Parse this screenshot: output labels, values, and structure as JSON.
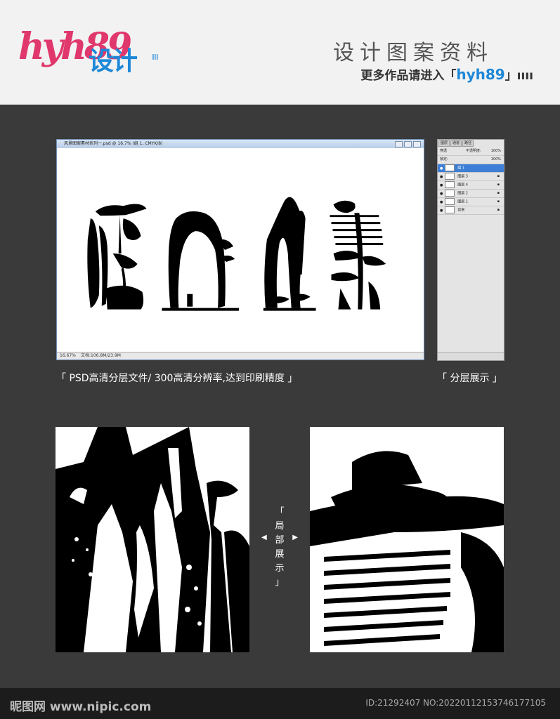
{
  "header": {
    "logo_latin": "hyh89",
    "logo_cn": "设计",
    "logo_bars": "ııı",
    "title": "设计图案资料",
    "subtitle_prefix": "更多作品请进入「",
    "subtitle_brand": "hyh89",
    "subtitle_suffix": "」ıııı"
  },
  "ps_window": {
    "title": "风景图案素材系列一.psd @ 16.7% (组 1, CMYK/8)",
    "zoom": "16.67%",
    "doc_info": "文档:106.8M/23.9M"
  },
  "layers_panel": {
    "tabs": [
      "图层",
      "通道",
      "路径"
    ],
    "blend_mode": "穿透",
    "opacity_label": "不透明度:",
    "opacity_value": "100%",
    "lock_label": "锁定:",
    "fill_value": "100%",
    "rows": [
      {
        "label": "组 1",
        "selected": true
      },
      {
        "label": "图层 3",
        "selected": false
      },
      {
        "label": "图层 4",
        "selected": false
      },
      {
        "label": "图层 2",
        "selected": false
      },
      {
        "label": "图层 1",
        "selected": false
      },
      {
        "label": "背景",
        "selected": false
      }
    ]
  },
  "captions": {
    "left": "「 PSD高清分层文件/ 300高清分辨率,达到印刷精度 」",
    "right": "「 分层展示 」"
  },
  "middle": {
    "open": "「",
    "chars": [
      "局",
      "部",
      "展",
      "示"
    ],
    "close": "」",
    "left_arrow": "◀",
    "right_arrow": "▶"
  },
  "footer": {
    "site": "昵图网 www.nipic.com",
    "id": "ID:21292407 NO:20220112153746177105"
  }
}
